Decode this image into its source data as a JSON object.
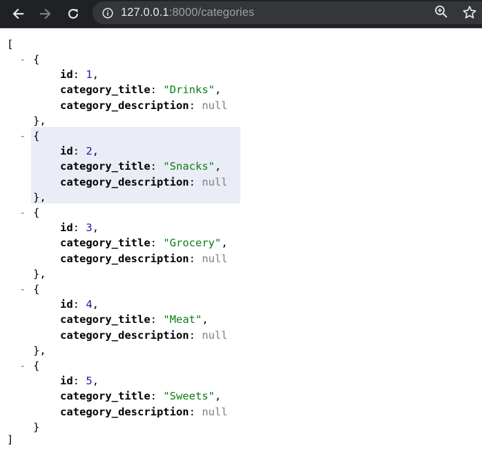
{
  "browser": {
    "url_host": "127.0.0.1",
    "url_rest": ":8000/categories",
    "icons": [
      "back-arrow-icon",
      "forward-arrow-icon",
      "reload-icon",
      "info-icon",
      "zoom-icon",
      "star-icon"
    ]
  },
  "json": {
    "open_bracket": "[",
    "close_bracket": "]",
    "collapse_marker": "-",
    "open_brace": "{",
    "close_brace": "}",
    "close_brace_comma": "},",
    "keys": {
      "id": "id",
      "title": "category_title",
      "description": "category_description"
    },
    "items": [
      {
        "id": "1",
        "category_title": "\"Drinks\"",
        "category_description": "null"
      },
      {
        "id": "2",
        "category_title": "\"Snacks\"",
        "category_description": "null"
      },
      {
        "id": "3",
        "category_title": "\"Grocery\"",
        "category_description": "null"
      },
      {
        "id": "4",
        "category_title": "\"Meat\"",
        "category_description": "null"
      },
      {
        "id": "5",
        "category_title": "\"Sweets\"",
        "category_description": "null"
      }
    ]
  },
  "colors": {
    "toolbar_bg": "#202124",
    "omnibox_bg": "#35363a",
    "string": "#0b7d11",
    "number": "#1a1aa6",
    "null": "#808080",
    "highlight": "#eaecf6"
  }
}
